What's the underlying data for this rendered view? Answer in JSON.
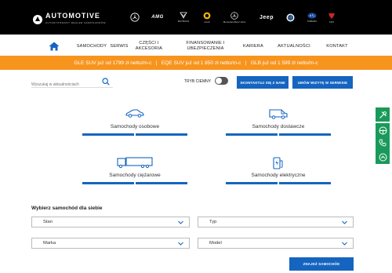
{
  "brandbar": {
    "logo_text": "AUTOMOTIVE",
    "logo_sub": "AUTORYZOWANY DEALER SAMOCHODÓW",
    "brands": [
      {
        "name": "Mercedes-Benz",
        "label": "",
        "sub": ""
      },
      {
        "name": "AMG",
        "label": "AMG",
        "sub": ""
      },
      {
        "name": "Maybach",
        "label": "",
        "sub": "MAYBACH"
      },
      {
        "name": "smart",
        "label": "",
        "sub": "smart"
      },
      {
        "name": "Mercedes-Benz Vans",
        "label": "",
        "sub": "Mercedes-Benz Vans"
      },
      {
        "name": "Jeep",
        "label": "Jeep",
        "sub": ""
      },
      {
        "name": "Alfa Romeo",
        "label": "",
        "sub": ""
      },
      {
        "name": "Subaru",
        "label": "",
        "sub": "SUBARU"
      },
      {
        "name": "Fiat Professional",
        "label": "",
        "sub": "FIAT"
      }
    ]
  },
  "nav": {
    "items": [
      {
        "label": "SAMOCHODY"
      },
      {
        "label": "SERWIS"
      },
      {
        "label": "CZĘŚCI I AKCESORIA"
      },
      {
        "label": "FINANSOWANIE I UBEZPIECZENIA"
      },
      {
        "label": "KARIERA"
      },
      {
        "label": "AKTUALNOŚCI"
      },
      {
        "label": "KONTAKT"
      }
    ]
  },
  "promo": {
    "items": [
      "GLE SUV już od 1799 zł netto/m-c",
      "EQE SUV już od 1 850 zł netto/m-c",
      "GLB już od 1 599 zł netto/m-c"
    ],
    "separator": "|"
  },
  "toolbar": {
    "search_placeholder": "Wyszukaj w aktualnościach",
    "dark_mode_label": "TRYB CIEMNY",
    "dark_mode_on": false,
    "contact_label": "SKONTAKTUJ SIĘ Z NAMI",
    "service_label": "UMÓW WIZYTĘ W SERWISIE"
  },
  "side_widgets": [
    {
      "icon": "tools-icon"
    },
    {
      "icon": "steering-wheel-icon"
    },
    {
      "icon": "phone-icon"
    },
    {
      "icon": "scroll-up-icon"
    }
  ],
  "categories": [
    {
      "label": "Samochody osobowe",
      "icon": "car-icon"
    },
    {
      "label": "Samochody dostawcze",
      "icon": "van-icon"
    },
    {
      "label": "Samochody ciężarowe",
      "icon": "truck-icon"
    },
    {
      "label": "Samochody elektryczne",
      "icon": "ev-charger-icon"
    }
  ],
  "selector": {
    "title": "Wybierz samochód dla siebie",
    "fields": [
      {
        "value": "Stan"
      },
      {
        "value": "Typ"
      },
      {
        "value": "Marka"
      },
      {
        "value": "Model"
      }
    ],
    "find_label": "ZNAJDŹ SAMOCHÓD"
  },
  "colors": {
    "accent": "#1565c0",
    "promo": "#f7941d",
    "side": "#1a9a5a",
    "header": "#000000"
  }
}
